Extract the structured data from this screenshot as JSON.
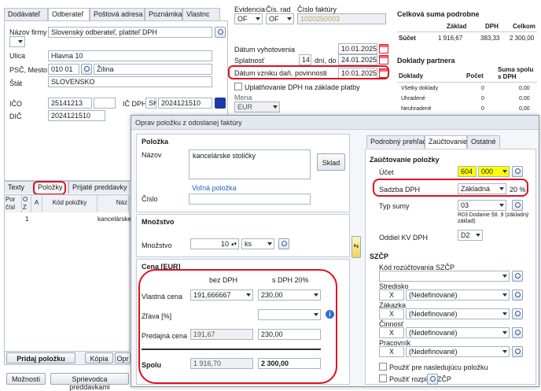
{
  "main_tabs": [
    "Dodávateľ",
    "Odberateľ",
    "Poštová adresa",
    "Poznámka",
    "Vlastnc"
  ],
  "customer": {
    "firm_label": "Názov firmy",
    "firm_value": "Slovenský odberateľ, platiteľ DPH",
    "street_label": "Ulica",
    "street_value": "Hlavna 10",
    "city_label": "PSČ, Mesto",
    "psc_value": "010 01",
    "city_value": "Žilina",
    "state_label": "Štát",
    "state_value": "SLOVENSKO",
    "ico_label": "IČO",
    "ico_value": "25141213",
    "icdph_label": "IČ DPH",
    "icdph_prefix": "SK",
    "icdph_value": "2024121510",
    "dic_label": "DIČ",
    "dic_value": "2024121510"
  },
  "doc": {
    "evidencia_label": "Evidencia",
    "cis_rad_label": "Čís. rad",
    "cislo_label": "Číslo faktúry",
    "evidencia_value": "OF",
    "cis_rad_value": "OF",
    "cislo_value": "1020250003",
    "vyhotovenia_label": "Dátum vyhotovenia",
    "vyhotovenia_value": "10.01.2025",
    "splatnost_label": "Splatnosť",
    "splatnost_days": "14",
    "splatnost_unit": "dní, do",
    "splatnost_value": "24.01.2025",
    "vznik_label": "Dátum vzniku daň. povinnosti",
    "vznik_value": "10.01.2025",
    "uplatnovanie_label": "Uplatňovanie DPH na základe platby",
    "mena_label": "Mena",
    "mena_value": "EUR"
  },
  "summary": {
    "title": "Celková suma podrobne",
    "col_zaklad": "Základ",
    "col_dph": "DPH",
    "col_celkom": "Celkom",
    "row_label": "Súčet",
    "zaklad": "1 916,67",
    "dph": "383,33",
    "celkom": "2 300,00"
  },
  "partner": {
    "title": "Doklady partnera",
    "col_doklady": "Doklady",
    "col_pocet": "Počet",
    "col_suma": "Suma spolu s DPH",
    "rows": [
      {
        "label": "Všetky doklady",
        "pocet": "0",
        "suma": "0,00"
      },
      {
        "label": "Uhradené",
        "pocet": "0",
        "suma": "0,00"
      },
      {
        "label": "Neuhradené",
        "pocet": "0",
        "suma": "0,00"
      }
    ]
  },
  "lower_tabs": [
    "Texty",
    "Položky",
    "Prijaté preddavky"
  ],
  "grid": {
    "headers": [
      "Por čísl",
      "O Z",
      "A",
      "Kód položky",
      "Náz"
    ],
    "row_num": "1",
    "row_name": "kancelárske"
  },
  "bottom_buttons": {
    "pridaj": "Pridaj položku",
    "kopia": "Kópia",
    "op": "Opr",
    "moznosti": "Možnosti",
    "sprievodca": "Sprievodca preddavkami"
  },
  "dialog": {
    "title": "Oprav položku z odoslanej faktúry",
    "polozka_section": "Položka",
    "nazov_label": "Názov",
    "nazov_value": "kancelárske stoličky",
    "sklad_button": "Sklad",
    "volna_polozka": "Voľná položka",
    "cislo_label": "Číslo",
    "mnozstvo_section": "Množstvo",
    "mnozstvo_label": "Množstvo",
    "mnozstvo_value": "10",
    "mnozstvo_unit": "ks",
    "cena_section": "Cena [EUR]",
    "col_bez": "bez DPH",
    "col_s": "s DPH 20%",
    "vlastna_label": "Vlastná cena",
    "vlastna_bez": "191,666667",
    "vlastna_s": "230,00",
    "zlava_label": "Zľava [%]",
    "predajna_label": "Predajná cena",
    "predajna_bez": "191,67",
    "predajna_s": "230,00",
    "spolu_label": "Spolu",
    "spolu_bez": "1 916,70",
    "spolu_s": "2 300,00",
    "right_tabs": [
      "Podrobný prehľad",
      "Zaúčtovanie",
      "Ostatné"
    ],
    "zauct_title": "Zaúčtovanie položky",
    "ucet_label": "Účet",
    "ucet_main": "604",
    "ucet_sub": "000",
    "sadzba_label": "Sadzba DPH",
    "sadzba_value": "Základná",
    "sadzba_pct": "20 %",
    "typ_label": "Typ sumy",
    "typ_value": "03",
    "typ_note": "R03 Dodanie §8. 9 (základný základ)",
    "oddiel_label": "Oddiel KV DPH",
    "oddiel_value": "D2",
    "szcp_title": "SZČP",
    "kod_label": "Kód rozúčtovania SZČP",
    "stredisko_label": "Stredisko",
    "zakazka_label": "Zákazka",
    "cinnost_label": "Činnosť",
    "pracovnik_label": "Pracovník",
    "x": "X",
    "nedef": "(Nedefinované)",
    "pouzit1": "Použiť pre nasledujúcu položku",
    "pouzit2": "Použiť rozpis SZČP"
  }
}
